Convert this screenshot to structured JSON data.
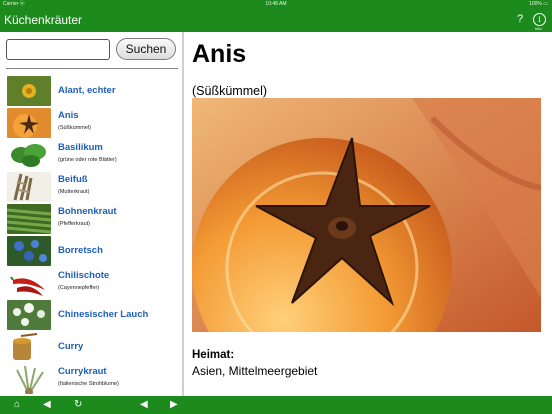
{
  "status_bar": {
    "carrier": "Carrier ⓦ",
    "time": "10:48 AM",
    "battery": "100% ▭"
  },
  "header": {
    "title": "Küchenkräuter",
    "help_label": "?",
    "info_label": "i",
    "info_caption": "Info"
  },
  "search": {
    "placeholder": "",
    "value": "",
    "button_label": "Suchen"
  },
  "herbs": [
    {
      "name": "Alant, echter",
      "subtitle": "",
      "thumb_color": "#6b8a2c"
    },
    {
      "name": "Anis",
      "subtitle": "(Süßkümmel)",
      "thumb_color": "#d2661c"
    },
    {
      "name": "Basilikum",
      "subtitle": "(grüne oder rote Blätter)",
      "thumb_color": "#3f8e32"
    },
    {
      "name": "Beifuß",
      "subtitle": "(Mutterkraut)",
      "thumb_color": "#8c8468"
    },
    {
      "name": "Bohnenkraut",
      "subtitle": "(Pfefferkraut)",
      "thumb_color": "#4c7a2a"
    },
    {
      "name": "Borretsch",
      "subtitle": "",
      "thumb_color": "#3f6a8c"
    },
    {
      "name": "Chilischote",
      "subtitle": "(Cayennepfeffer)",
      "thumb_color": "#c2201a"
    },
    {
      "name": "Chinesischer Lauch",
      "subtitle": "",
      "thumb_color": "#5f8a4a"
    },
    {
      "name": "Curry",
      "subtitle": "",
      "thumb_color": "#c78c32"
    },
    {
      "name": "Currykraut",
      "subtitle": "(Italienische Strohblume)",
      "thumb_color": "#8ca46a"
    }
  ],
  "detail": {
    "title": "Anis",
    "subtitle": "(Süßkümmel)",
    "heimat_label": "Heimat:",
    "heimat_value": "Asien, Mittelmeergebiet"
  },
  "toolbar": {
    "home_icon": "⌂",
    "back_icon": "◀",
    "refresh_icon": "↻",
    "prev_icon": "◀",
    "next_icon": "▶"
  },
  "colors": {
    "brand": "#1c8a1c",
    "link": "#1f5fb8"
  }
}
